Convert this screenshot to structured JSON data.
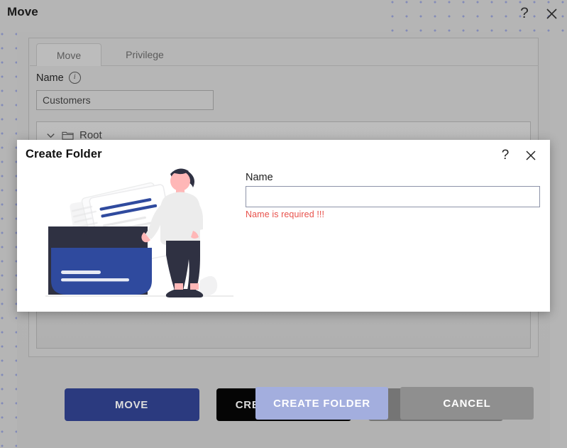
{
  "page": {
    "title": "Move",
    "help_icon": "question-mark-icon",
    "close_icon": "close-x-icon"
  },
  "move_dialog": {
    "tabs": [
      {
        "id": "move",
        "label": "Move",
        "active": true
      },
      {
        "id": "privilege",
        "label": "Privilege",
        "active": false
      }
    ],
    "name_label": "Name",
    "name_info_icon": "i",
    "name_value": "Customers",
    "name_placeholder": "",
    "tree": {
      "root_label": "Root",
      "chevron_icon": "chevron-down-icon",
      "folder_icon": "folder-icon"
    },
    "actions": {
      "move_label": "MOVE",
      "create_folder_label": "CREATE FOLDER",
      "cancel_label": "CANCEL"
    },
    "colors": {
      "move_button": "#2b3a7f",
      "create_folder_button": "#050505",
      "cancel_button": "#757575",
      "overlay": "#b5b5b5",
      "dot_pattern": "#7b85b4"
    }
  },
  "create_folder_modal": {
    "title": "Create Folder",
    "help_icon": "question-mark-icon",
    "close_icon": "close-x-icon",
    "illustration_name": "person-with-folder-documents-illustration",
    "name_label": "Name",
    "name_value": "",
    "name_placeholder": "",
    "error_message": "Name is required !!!",
    "actions": {
      "create_folder_label": "CREATE FOLDER",
      "cancel_label": "CANCEL"
    },
    "colors": {
      "create_folder_button": "#a3aede",
      "cancel_button": "#8f8f8f",
      "error_text": "#e8514b",
      "illustration_accent": "#2f4a9e"
    }
  }
}
